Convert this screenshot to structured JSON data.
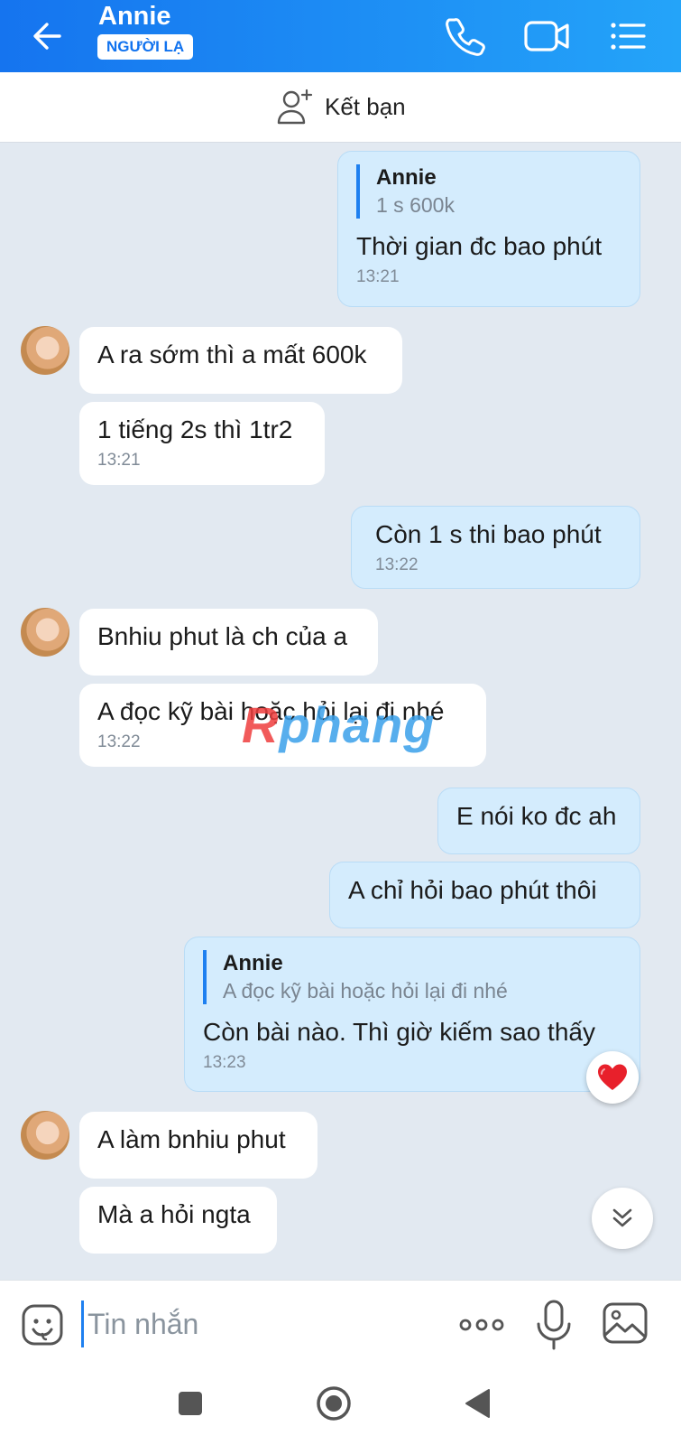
{
  "header": {
    "contact_name": "Annie",
    "badge": "NGƯỜI LẠ",
    "icons": [
      "back-arrow-icon",
      "phone-icon",
      "video-camera-icon",
      "menu-list-icon"
    ]
  },
  "add_friend": {
    "label": "Kết bạn",
    "icon": "add-user-icon"
  },
  "messages": [
    {
      "side": "mine",
      "quote": {
        "name": "Annie",
        "text": "1 s 600k"
      },
      "text": "Thời gian đc bao phút",
      "time": "13:21"
    },
    {
      "side": "theirs",
      "text": "A ra sớm thì a mất 600k"
    },
    {
      "side": "theirs",
      "text": "1 tiếng 2s thì 1tr2",
      "time": "13:21"
    },
    {
      "side": "mine",
      "text": "Còn 1 s thi bao phút",
      "time": "13:22"
    },
    {
      "side": "theirs",
      "text": "Bnhiu phut là ch của a"
    },
    {
      "side": "theirs",
      "text": "A đọc kỹ bài hoặc hỏi lại đi nhé",
      "time": "13:22"
    },
    {
      "side": "mine",
      "text": "E nói ko đc ah"
    },
    {
      "side": "mine",
      "text": "A chỉ hỏi bao phút thôi"
    },
    {
      "side": "mine",
      "quote": {
        "name": "Annie",
        "text": "A đọc kỹ bài hoặc hỏi lại đi nhé"
      },
      "text": "Còn bài nào. Thì giờ kiếm sao thấy",
      "time": "13:23"
    },
    {
      "side": "theirs",
      "text": "A làm bnhiu phut"
    },
    {
      "side": "theirs",
      "text": "Mà a hỏi ngta"
    }
  ],
  "watermark": {
    "first": "R",
    "rest": "phang"
  },
  "input": {
    "placeholder": "Tin nhắn"
  },
  "colors": {
    "header_start": "#1574ef",
    "header_end": "#24a4f9",
    "mine_bubble": "#d4ecfd",
    "theirs_bubble": "#ffffff",
    "chat_bg": "#e2e9f1",
    "accent": "#1e80f0"
  }
}
